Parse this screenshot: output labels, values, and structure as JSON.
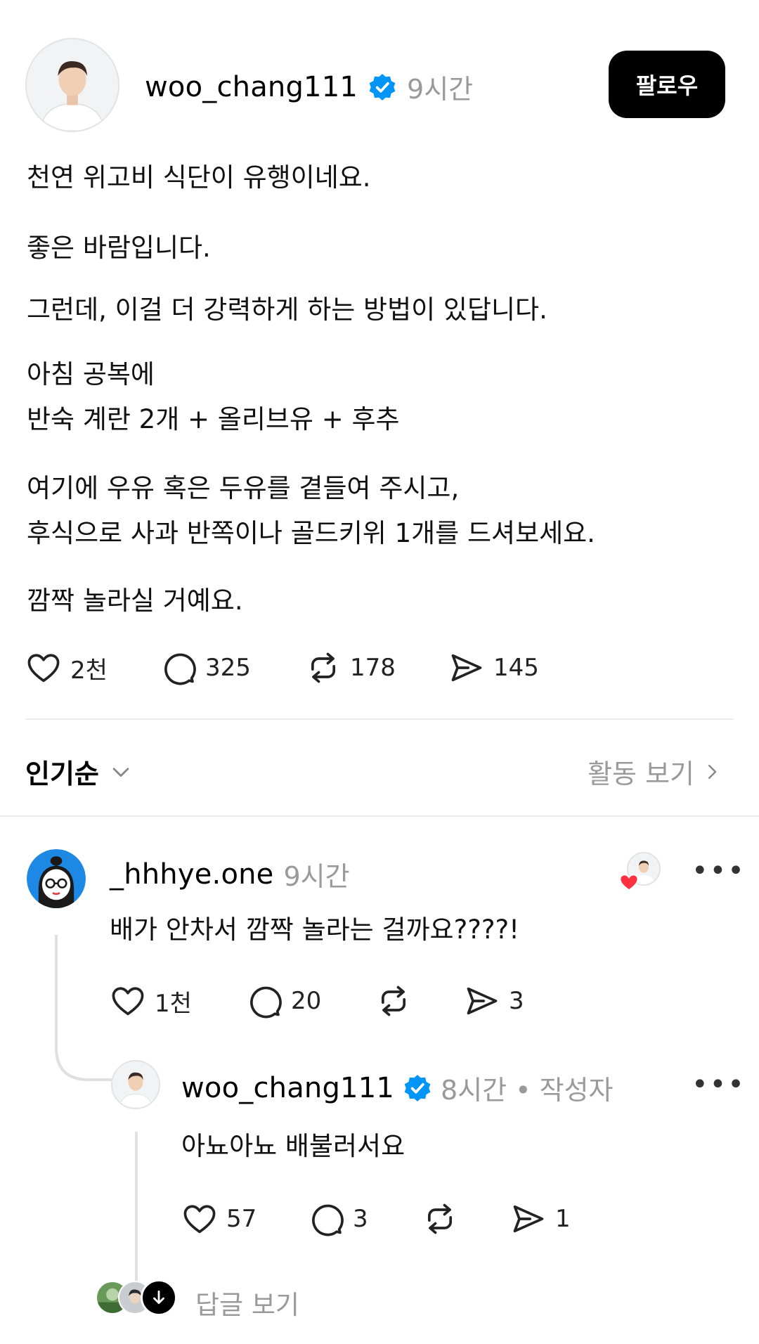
{
  "post": {
    "username": "woo_chang111",
    "time": "9시간",
    "follow_label": "팔로우",
    "lines": [
      "천연 위고비 식단이 유행이네요.",
      "좋은 바람입니다.",
      "그런데, 이걸 더 강력하게 하는 방법이 있답니다.",
      "아침 공복에",
      "반숙 계란 2개 + 올리브유 + 후추",
      "여기에 우유 혹은 두유를 곁들여 주시고,",
      "후식으로 사과 반쪽이나 골드키위 1개를 드셔보세요.",
      "깜짝 놀라실 거예요."
    ],
    "likes": "2천",
    "comments": "325",
    "reposts": "178",
    "shares": "145"
  },
  "sort": {
    "label": "인기순",
    "activity_label": "활동 보기"
  },
  "comment": {
    "username": "_hhhye.one",
    "time": "9시간",
    "text": "배가 안차서 깜짝 놀라는 걸까요????!",
    "likes": "1천",
    "comments": "20",
    "shares": "3"
  },
  "reply": {
    "username": "woo_chang111",
    "time": "8시간",
    "author_tag": "• 작성자",
    "text": "아뇨아뇨 배불러서요",
    "likes": "57",
    "comments": "3",
    "shares": "1",
    "view_replies_label": "답글 보기"
  },
  "colors": {
    "verified": "#0095f6",
    "heart": "#ff3040",
    "muted": "#9a9a9a"
  }
}
